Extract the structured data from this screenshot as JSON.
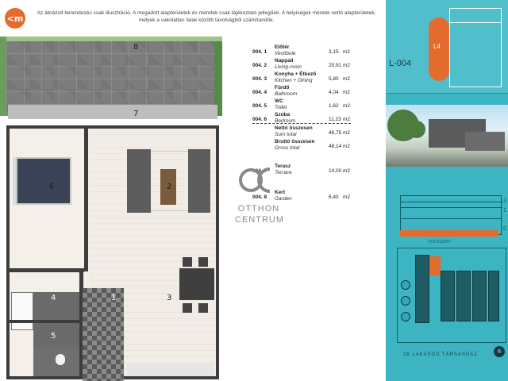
{
  "brand": {
    "logo_text": "<m"
  },
  "disclaimer": "Az ábrázolt berendezés csak illusztráció. A megadott alapterületek és méretek csak tájékoztató jellegűek. A helyiségek méretei nettó alapterületek, melyek a vakolatlan falak közötti távolságból számítandók.",
  "floor_plan": {
    "labels": {
      "garden": "8",
      "terrace": "7",
      "bedroom": "6",
      "living": "2",
      "kitchen": "3",
      "vestibule": "1",
      "bathroom": "4",
      "toilet": "5"
    }
  },
  "rooms": [
    {
      "code": "004.",
      "num": "1",
      "name": "Előtér",
      "sub": "Vestibule",
      "area": "3,15",
      "unit": "m2"
    },
    {
      "code": "004.",
      "num": "2",
      "name": "Nappali",
      "sub": "Living-room",
      "area": "20,91",
      "unit": "m2"
    },
    {
      "code": "004.",
      "num": "3",
      "name": "Konyha + Étkező",
      "sub": "Kitchen + Dining",
      "area": "5,80",
      "unit": "m2"
    },
    {
      "code": "004.",
      "num": "4",
      "name": "Fürdő",
      "sub": "Bathroom",
      "area": "4,04",
      "unit": "m2"
    },
    {
      "code": "004.",
      "num": "5",
      "name": "WC",
      "sub": "Toilet",
      "area": "1,62",
      "unit": "m2"
    },
    {
      "code": "004.",
      "num": "6",
      "name": "Szoba",
      "sub": "Bedroom",
      "area": "11,23",
      "unit": "m2"
    }
  ],
  "totals": [
    {
      "name": "Nettó összesen",
      "sub": "Sum total",
      "area": "46,75",
      "unit": "m2"
    },
    {
      "name": "Bruttó összesen",
      "sub": "Gross total",
      "area": "48,14",
      "unit": "m2"
    }
  ],
  "extras": [
    {
      "code": "004.",
      "num": "7",
      "name": "Terasz",
      "sub": "Terrace",
      "area": "14,00",
      "unit": "m2"
    },
    {
      "code": "004.",
      "num": "8",
      "name": "Kert",
      "sub": "Garden",
      "area": "6,40",
      "unit": "m2"
    }
  ],
  "watermark": {
    "line1": "OTTHON",
    "line2": "CENTRUM"
  },
  "panel": {
    "lot_label": "L-004",
    "lot_tag": "L4",
    "site_numbers": [
      "2",
      "1",
      "0"
    ],
    "site_label": "FÖLDSZINT",
    "footer": "28 LAKÁSOS TÁRSASHÁZ",
    "accent": "#e36b2c",
    "teal": "#3cb4c2"
  }
}
